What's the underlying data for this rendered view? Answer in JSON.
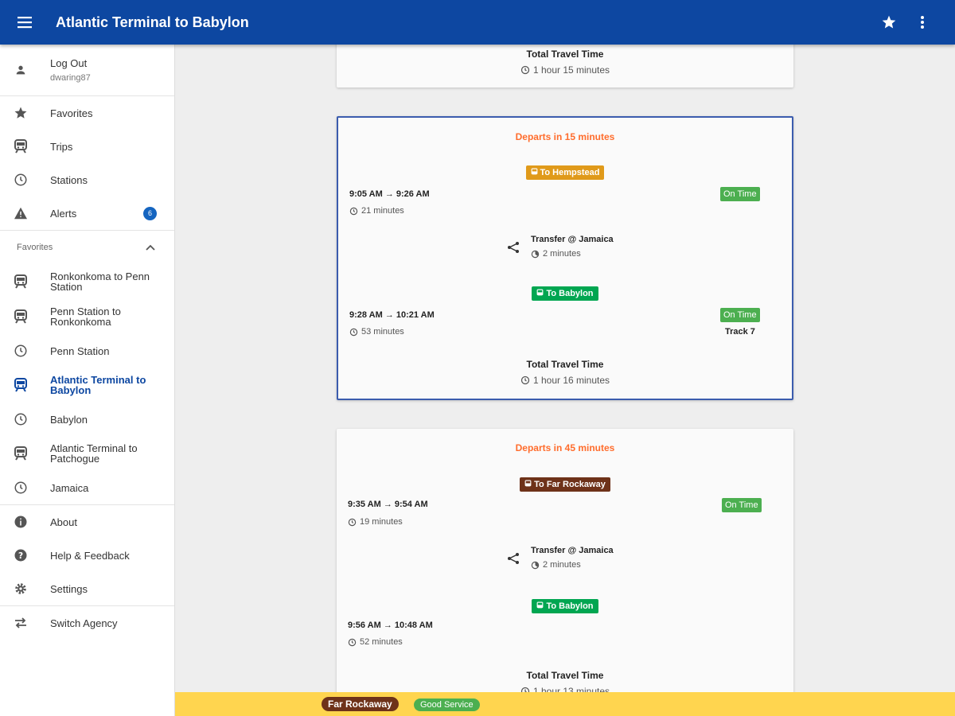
{
  "app": {
    "title": "Atlantic Terminal to Babylon"
  },
  "account": {
    "action": "Log Out",
    "username": "dwaring87"
  },
  "drawer": {
    "favorites": "Favorites",
    "trips": "Trips",
    "stations": "Stations",
    "alerts": "Alerts",
    "alerts_count": "6",
    "favorites_header": "Favorites",
    "fav_items": [
      {
        "label": "Ronkonkoma to Penn Station",
        "icon": "train-icon"
      },
      {
        "label": "Penn Station to Ronkonkoma",
        "icon": "train-icon"
      },
      {
        "label": "Penn Station",
        "icon": "clock-icon"
      },
      {
        "label": "Atlantic Terminal to Babylon",
        "icon": "train-icon"
      },
      {
        "label": "Babylon",
        "icon": "clock-icon"
      },
      {
        "label": "Atlantic Terminal to Patchogue",
        "icon": "train-icon"
      },
      {
        "label": "Jamaica",
        "icon": "clock-icon"
      }
    ],
    "about": "About",
    "help": "Help & Feedback",
    "settings": "Settings",
    "switch_agency": "Switch Agency"
  },
  "cards": [
    {
      "total_label": "Total Travel Time",
      "total_value": "1 hour 15 minutes"
    },
    {
      "departs": "Departs in 15 minutes",
      "leg1": {
        "route": "To Hempstead",
        "route_color": "#e09a1a",
        "times": "9:05 AM → 9:26 AM",
        "duration": "21 minutes",
        "status": "On Time"
      },
      "transfer": {
        "title": "Transfer @ Jamaica",
        "duration": "2 minutes"
      },
      "leg2": {
        "route": "To Babylon",
        "route_color": "#00a651",
        "times": "9:28 AM → 10:21 AM",
        "duration": "53 minutes",
        "status": "On Time",
        "track": "Track 7"
      },
      "total_label": "Total Travel Time",
      "total_value": "1 hour 16 minutes"
    },
    {
      "departs": "Departs in 45 minutes",
      "leg1": {
        "route": "To Far Rockaway",
        "route_color": "#6e3219",
        "times": "9:35 AM → 9:54 AM",
        "duration": "19 minutes",
        "status": "On Time"
      },
      "transfer": {
        "title": "Transfer @ Jamaica",
        "duration": "2 minutes"
      },
      "leg2": {
        "route": "To Babylon",
        "route_color": "#00a651",
        "times": "9:56 AM → 10:48 AM",
        "duration": "52 minutes"
      },
      "total_label": "Total Travel Time",
      "total_value": "1 hour 13 minutes"
    }
  ],
  "service_status": {
    "line": "Far Rockaway",
    "line_color": "#6e3219",
    "status": "Good Service",
    "status_color": "#4caf50"
  },
  "colors": {
    "primary": "#0d47a1",
    "accent_orange": "#ff6d2d",
    "on_time": "#4caf50",
    "status_bar": "#ffd54f"
  }
}
